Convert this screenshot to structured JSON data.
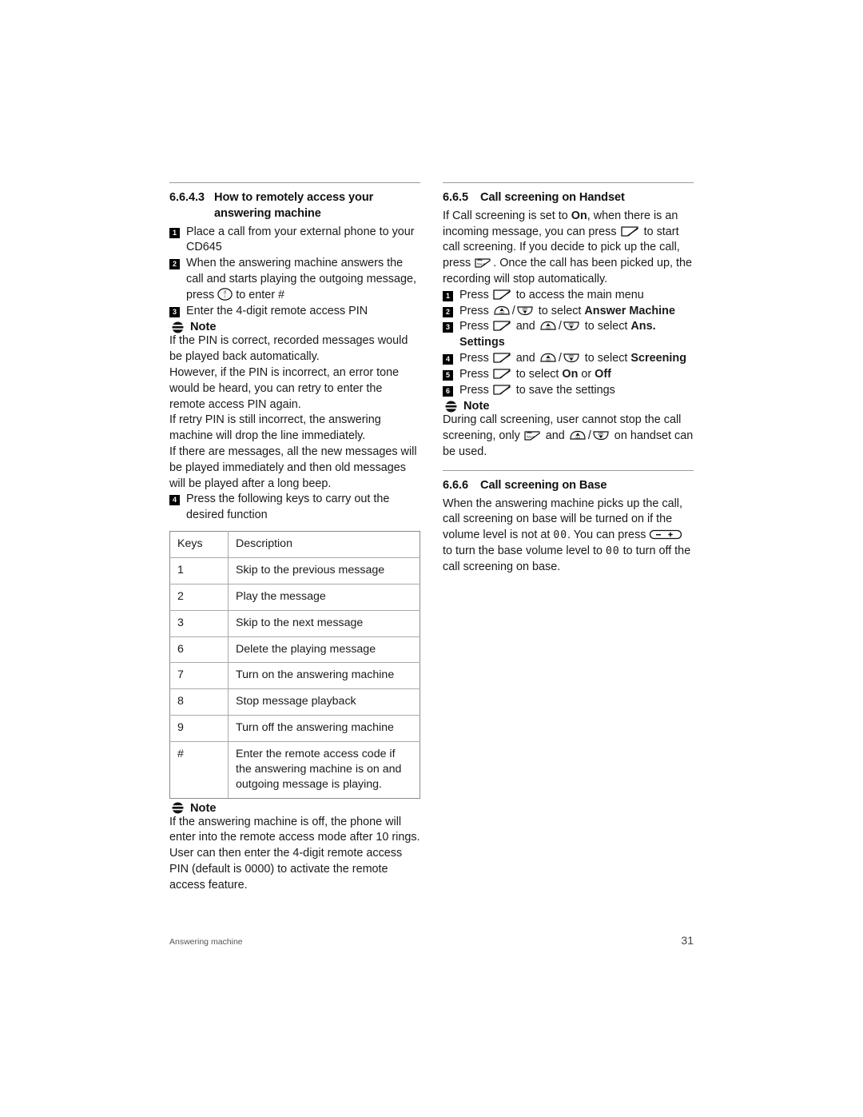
{
  "document": {
    "footer_left": "Answering machine",
    "page_number": "31"
  },
  "left_column": {
    "section": {
      "number": "6.6.4.3",
      "title_line1": "How to remotely access your",
      "title_line2": "answering machine"
    },
    "steps": [
      {
        "marker": "1",
        "text": "Place a call from your external phone to your CD645"
      },
      {
        "marker": "2",
        "text_before_icon": "When the answering machine answers the call and starts playing the outgoing message, press ",
        "icon": "hash-key-icon",
        "text_after_icon": " to enter #"
      },
      {
        "marker": "3",
        "text": "Enter the 4-digit remote access PIN"
      }
    ],
    "note1": {
      "icon": "note-icon",
      "title": "Note",
      "paragraphs": [
        "If the PIN is correct, recorded messages would be played back automatically.",
        "However, if the PIN is incorrect, an error tone would be heard, you can retry to enter the remote access PIN again.",
        "If retry PIN is still incorrect, the answering machine will drop the line immediately.",
        "If there are messages, all the new messages will be played immediately and then old messages will be played after a long beep."
      ]
    },
    "step4": {
      "marker": "4",
      "text": "Press the following keys to carry out the desired function"
    },
    "table": {
      "headers": [
        "Keys",
        "Description"
      ],
      "rows": [
        [
          "1",
          "Skip to the previous message"
        ],
        [
          "2",
          "Play the message"
        ],
        [
          "3",
          "Skip to the next message"
        ],
        [
          "6",
          "Delete the playing message"
        ],
        [
          "7",
          "Turn on the answering machine"
        ],
        [
          "8",
          "Stop message playback"
        ],
        [
          "9",
          "Turn off the answering machine"
        ],
        [
          "#",
          "Enter the remote access code if the answering machine is on and outgoing message is playing."
        ]
      ]
    },
    "note2": {
      "icon": "note-icon",
      "title": "Note",
      "paragraphs": [
        "If the answering machine is off, the phone will enter into the remote access mode after 10 rings. User can then enter the 4-digit remote access PIN (default is 0000) to activate the remote access feature."
      ]
    }
  },
  "right_column": {
    "section1": {
      "number": "6.6.5",
      "title": "Call screening on Handset",
      "intro": {
        "p1_a": "If Call screening is set to ",
        "p1_bold": "On",
        "p1_b": ", when there is an incoming message, you can press ",
        "p1_icon": "soft-key-icon",
        "p1_c": " to start call screening. If you decide to pick up the call, press ",
        "p1_icon2": "talk-key-icon",
        "p1_d": ". Once the call has been picked up, the recording will stop automatically."
      },
      "steps": [
        {
          "marker": "1",
          "a": "Press ",
          "icon1": "soft-key-icon",
          "b": " to access the main menu"
        },
        {
          "marker": "2",
          "a": "Press ",
          "icon1": "up-cid-key-icon",
          "sep": "/",
          "icon2": "down-pbk-key-icon",
          "b": " to select ",
          "bold": "Answer Machine"
        },
        {
          "marker": "3",
          "a": "Press ",
          "icon1": "soft-key-icon",
          "mid": " and ",
          "icon2": "up-cid-key-icon",
          "sep": "/",
          "icon3": "down-pbk-key-icon",
          "b": " to select ",
          "bold": "Ans.",
          "bold_line2": "Settings"
        },
        {
          "marker": "4",
          "a": "Press ",
          "icon1": "soft-key-icon",
          "mid": " and ",
          "icon2": "up-cid-key-icon",
          "sep": "/",
          "icon3": "down-pbk-key-icon",
          "b": " to select ",
          "bold": "Screening"
        },
        {
          "marker": "5",
          "a": "Press ",
          "icon1": "soft-key-icon",
          "b": " to select ",
          "bold": "On",
          "b2": " or ",
          "bold2": "Off"
        },
        {
          "marker": "6",
          "a": "Press ",
          "icon1": "soft-key-icon",
          "b": " to save the settings"
        }
      ],
      "note": {
        "icon": "note-icon",
        "title": "Note",
        "a": "During call screening, user cannot stop the call screening, only ",
        "icon1": "talk-key-icon",
        "mid": " and ",
        "icon2": "up-cid-key-icon",
        "sep": "/",
        "icon3": "down-pbk-key-icon",
        "b": " on handset can be used."
      }
    },
    "section2": {
      "number": "6.6.6",
      "title": "Call screening on Base",
      "body": {
        "a": "When the answering machine picks up the call, call screening on base will be turned on if the volume level is not at ",
        "lcd1": "00",
        "b": ". You can press ",
        "icon": "volume-key-icon",
        "c": " to turn the base volume level to ",
        "lcd2": "00",
        "d": " to turn off the call screening on base."
      }
    }
  }
}
